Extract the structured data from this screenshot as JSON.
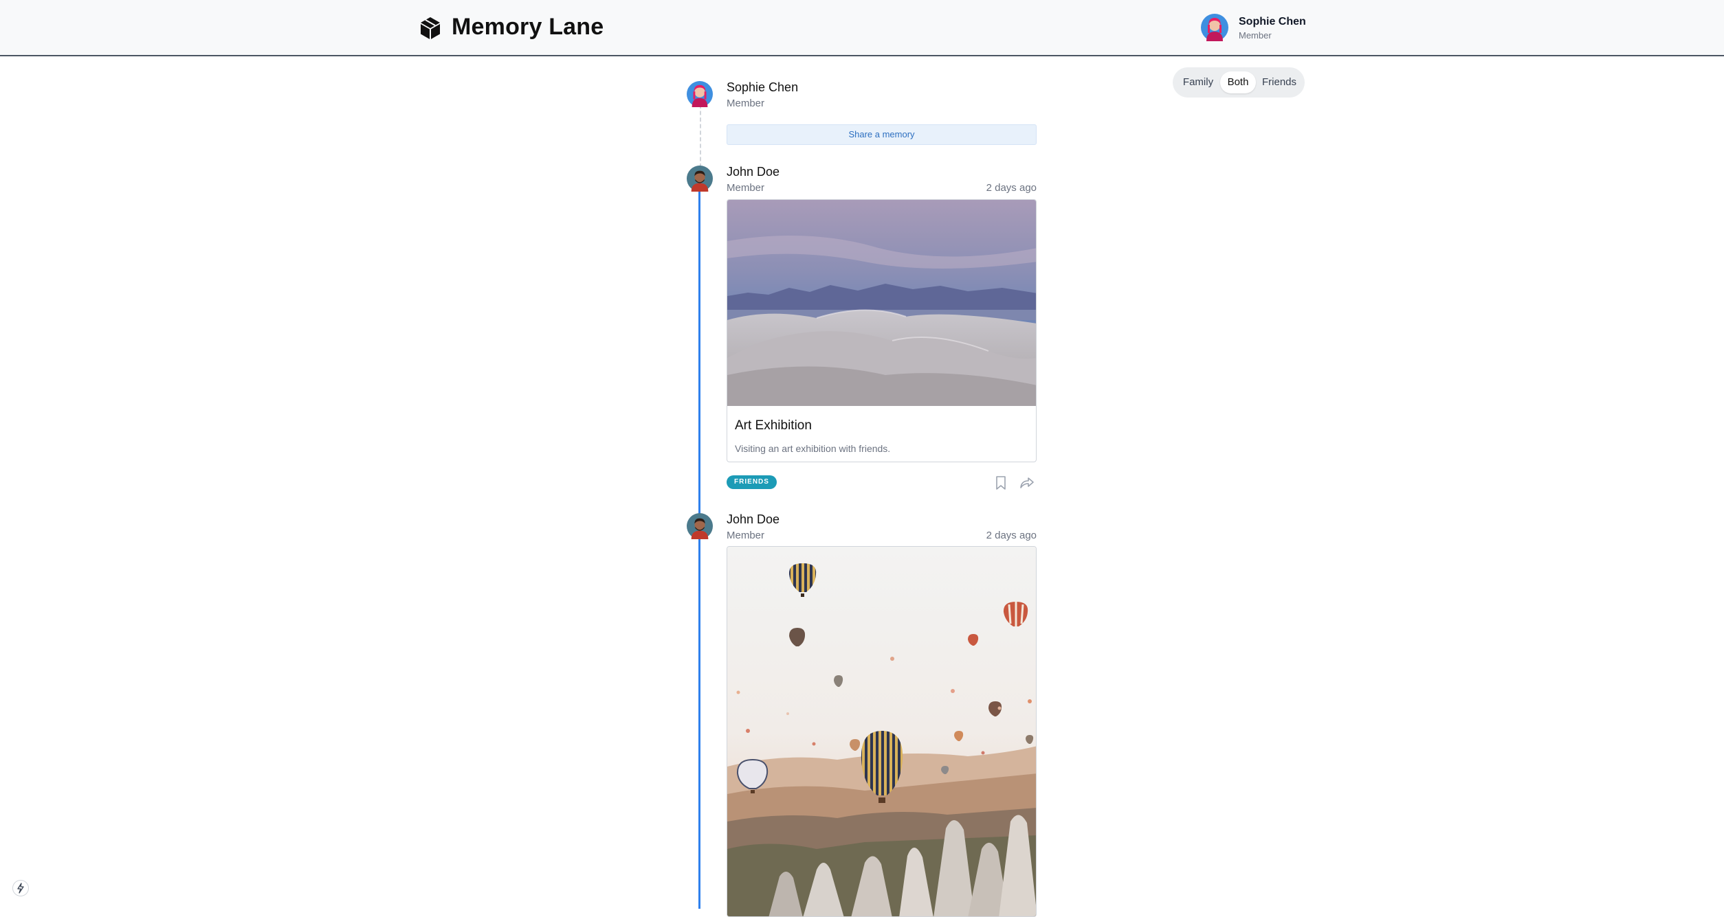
{
  "header": {
    "app_title": "Memory Lane",
    "logo_icon": "cube-icon",
    "user": {
      "name": "Sophie Chen",
      "role": "Member"
    }
  },
  "filter": {
    "options": [
      "Family",
      "Both",
      "Friends"
    ],
    "selected": "Both"
  },
  "composer": {
    "user_name": "Sophie Chen",
    "user_role": "Member",
    "share_label": "Share a memory"
  },
  "posts": [
    {
      "author": "John Doe",
      "role": "Member",
      "time": "2 days ago",
      "image": "desert-dunes-photo",
      "title": "Art Exhibition",
      "description": "Visiting an art exhibition with friends.",
      "tag": "FRIENDS"
    },
    {
      "author": "John Doe",
      "role": "Member",
      "time": "2 days ago",
      "image": "hot-air-balloons-photo"
    }
  ],
  "colors": {
    "timeline": "#2f80ed",
    "tag": "#1c9bb6",
    "share_bg": "#e8f1fb",
    "share_text": "#2d6fc0"
  }
}
